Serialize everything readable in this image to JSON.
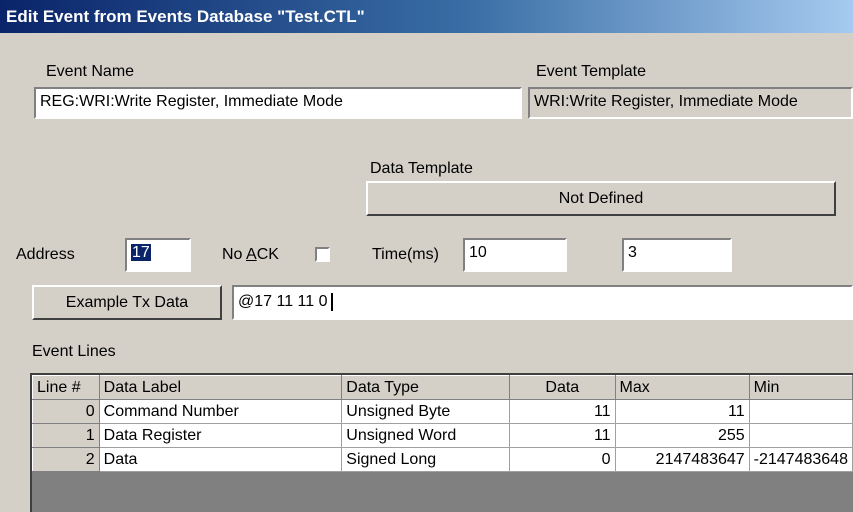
{
  "window": {
    "title": "Edit Event from Events Database \"Test.CTL\""
  },
  "event_name": {
    "label": "Event Name",
    "value": "REG:WRI:Write Register, Immediate Mode"
  },
  "event_template": {
    "label": "Event Template",
    "value": "WRI:Write Register, Immediate Mode"
  },
  "data_template": {
    "label": "Data Template",
    "button_label": "Not Defined"
  },
  "address": {
    "label": "Address",
    "value": "17"
  },
  "no_ack": {
    "label_prefix": "No ",
    "label_accel": "A",
    "label_suffix": "CK",
    "checked": false
  },
  "time_ms": {
    "label": "Time(ms)",
    "value": "10"
  },
  "extra_field": {
    "value": "3"
  },
  "example_tx": {
    "button_label": "Example Tx Data",
    "value": "@17 11 11 0"
  },
  "event_lines": {
    "label": "Event Lines",
    "columns": [
      "Line #",
      "Data Label",
      "Data Type",
      "Data",
      "Max",
      "Min"
    ],
    "rows": [
      {
        "line": "0",
        "data_label": "Command Number",
        "data_type": "Unsigned Byte",
        "data": "11",
        "max": "11",
        "min": ""
      },
      {
        "line": "1",
        "data_label": "Data Register",
        "data_type": "Unsigned Word",
        "data": "11",
        "max": "255",
        "min": ""
      },
      {
        "line": "2",
        "data_label": "Data",
        "data_type": "Signed Long",
        "data": "0",
        "max": "2147483647",
        "min": "-2147483648"
      }
    ]
  }
}
